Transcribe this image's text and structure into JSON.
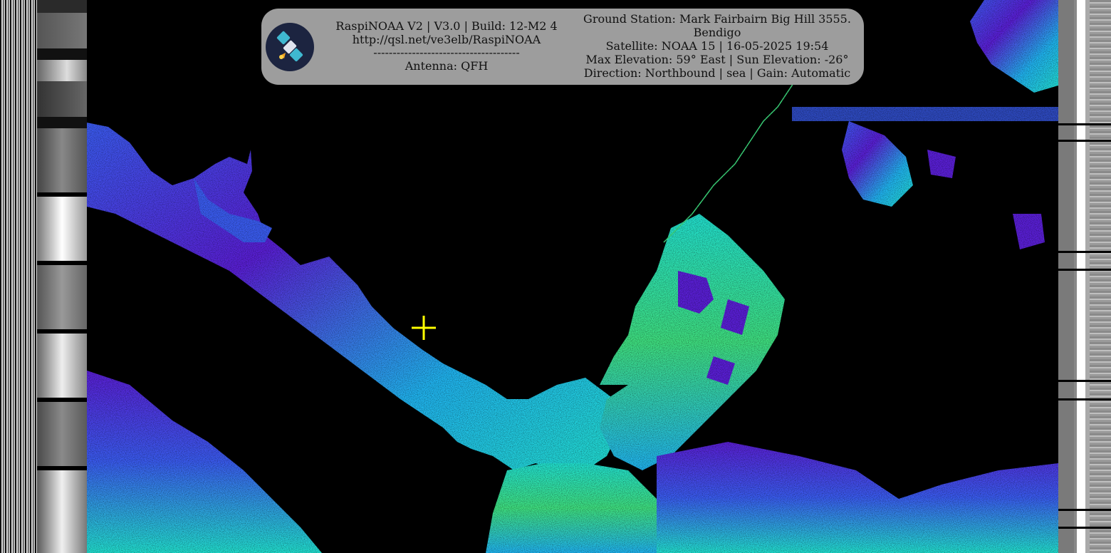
{
  "banner": {
    "left": {
      "line1": "RaspiNOAA V2 | V3.0 | Build: 12-M2 4",
      "line2": "http://qsl.net/ve3elb/RaspiNOAA",
      "divider": "--------------------------------------",
      "line4": "Antenna: QFH"
    },
    "right": {
      "line1": "Ground Station: Mark Fairbairn Big Hill 3555.",
      "line2": "Bendigo",
      "line3": "Satellite: NOAA 15 | 16-05-2025 19:54",
      "line4": "Max Elevation: 59° East | Sun Elevation: -26°",
      "line5": "Direction: Northbound | sea | Gain: Automatic"
    }
  },
  "colors": {
    "banner_bg": "#9d9d9d",
    "crosshair": "#ffff00",
    "palette": [
      "#5a1fd6",
      "#3a5cf0",
      "#20b4f0",
      "#22e0d0",
      "#3fe080",
      "#d0f040",
      "#ffe000"
    ]
  },
  "icons": {
    "logo": "satellite-logo-icon",
    "crosshair": "crosshair-icon"
  }
}
